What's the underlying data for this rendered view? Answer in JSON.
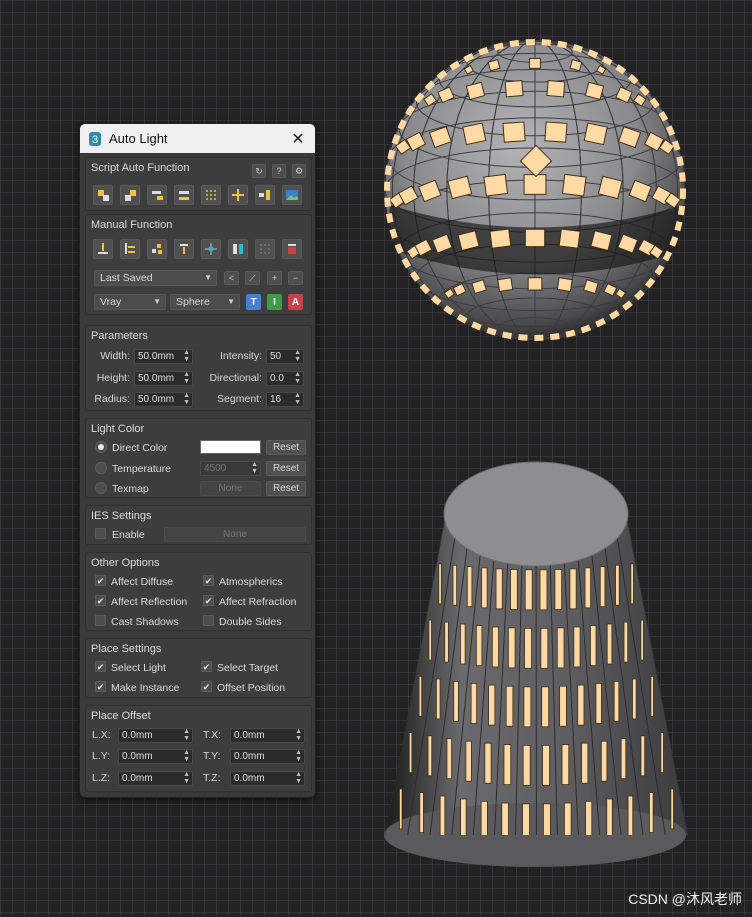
{
  "window": {
    "title": "Auto Light"
  },
  "script_auto": {
    "title": "Script Auto Function",
    "header_icons": [
      "refresh-icon",
      "help-icon",
      "settings-icon"
    ],
    "help_label": "?",
    "tools": [
      "align-top-left-icon",
      "align-top-right-icon",
      "align-right-icon",
      "align-bottom-icon",
      "grid-dots-icon",
      "plus-icon",
      "place-light-icon",
      "image-icon"
    ]
  },
  "manual": {
    "title": "Manual Function",
    "tools": [
      "light-down-icon",
      "light-left-icon",
      "light-cluster-icon",
      "stack-icon",
      "center-icon",
      "split-icon",
      "grid-icon",
      "delete-red-icon"
    ],
    "preset_value": "Last Saved",
    "preset_buttons": [
      "<",
      "⟋",
      "+",
      "−"
    ],
    "renderer_value": "Vray",
    "shape_value": "Sphere",
    "type_buttons": [
      {
        "label": "T",
        "color": "#4a7fd0"
      },
      {
        "label": "I",
        "color": "#3f9a4a"
      },
      {
        "label": "A",
        "color": "#c8404a"
      }
    ]
  },
  "parameters": {
    "title": "Parameters",
    "width_label": "Width:",
    "width_value": "50.0mm",
    "height_label": "Height:",
    "height_value": "50.0mm",
    "radius_label": "Radius:",
    "radius_value": "50.0mm",
    "intensity_label": "Intensity:",
    "intensity_value": "50",
    "directional_label": "Directional:",
    "directional_value": "0.0",
    "segment_label": "Segment:",
    "segment_value": "16"
  },
  "light_color": {
    "title": "Light Color",
    "direct_label": "Direct Color",
    "direct_swatch": "#ffffff",
    "temperature_label": "Temperature",
    "temperature_value": "4500",
    "texmap_label": "Texmap",
    "texmap_value": "None",
    "reset_label": "Reset"
  },
  "ies": {
    "title": "IES Settings",
    "enable_label": "Enable",
    "file_value": "None"
  },
  "other_options": {
    "title": "Other Options",
    "affect_diffuse": "Affect Diffuse",
    "atmospherics": "Atmospherics",
    "affect_reflection": "Affect Reflection",
    "affect_refraction": "Affect Refraction",
    "cast_shadows": "Cast Shadows",
    "double_sides": "Double Sides"
  },
  "place_settings": {
    "title": "Place Settings",
    "select_light": "Select Light",
    "select_target": "Select Target",
    "make_instance": "Make Instance",
    "offset_position": "Offset Position"
  },
  "place_offset": {
    "title": "Place Offset",
    "lx_label": "L.X:",
    "lx_value": "0.0mm",
    "ly_label": "L.Y:",
    "ly_value": "0.0mm",
    "lz_label": "L.Z:",
    "lz_value": "0.0mm",
    "tx_label": "T.X:",
    "tx_value": "0.0mm",
    "ty_label": "T.Y:",
    "ty_value": "0.0mm",
    "tz_label": "T.Z:",
    "tz_value": "0.0mm"
  },
  "viewport": {
    "sphere_color": "#8a8a8c",
    "cone_color": "#7d7d7f",
    "light_color": "#ffd9a3"
  },
  "watermark": "CSDN @沐风老师",
  "check_mark": "✔"
}
